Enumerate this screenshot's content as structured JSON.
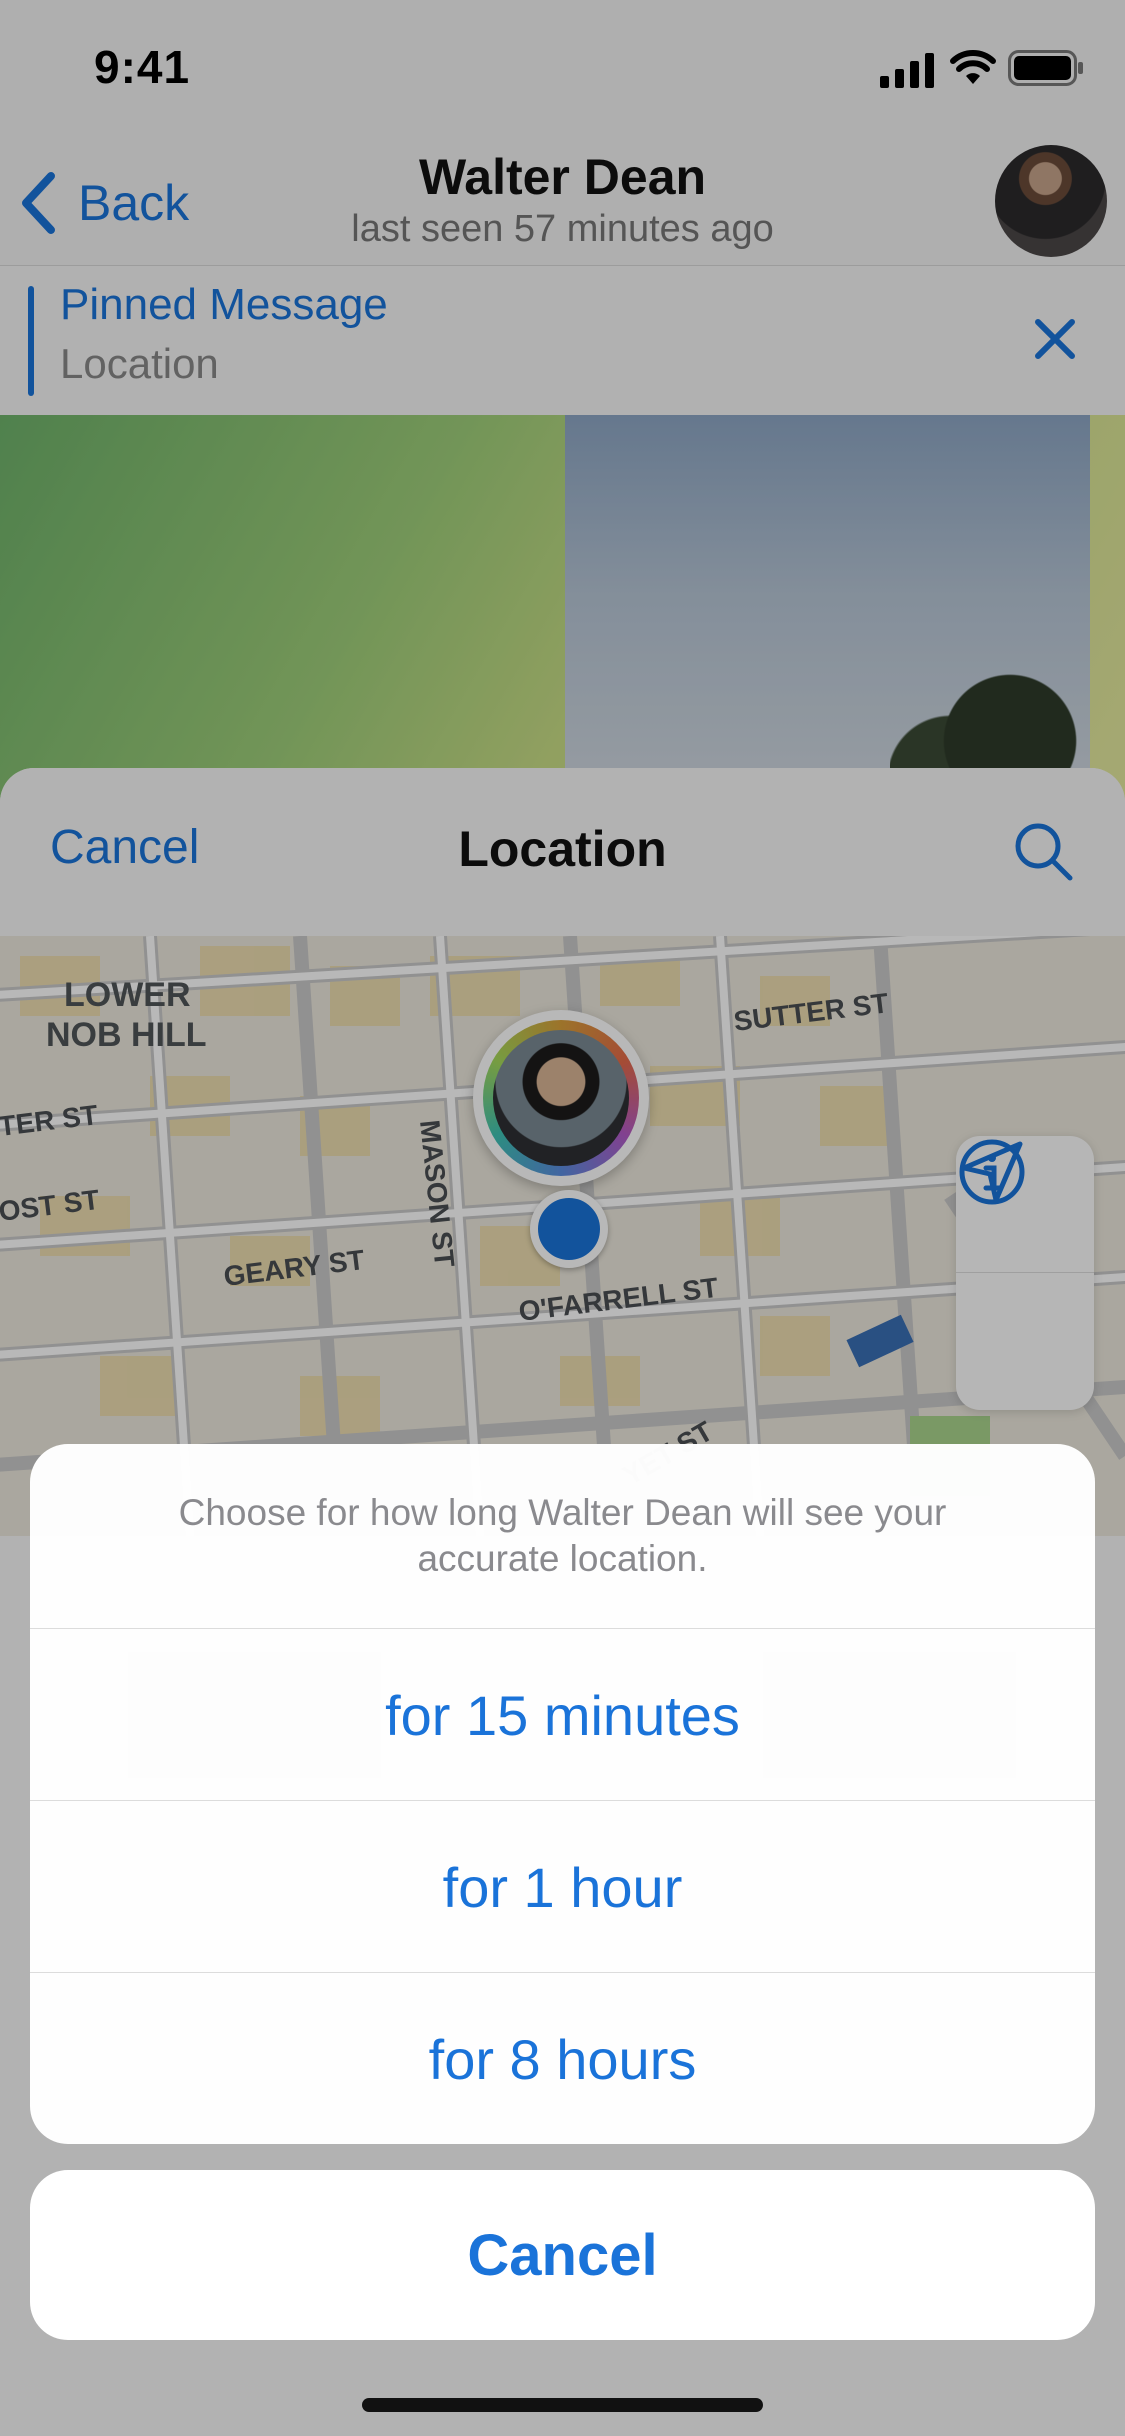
{
  "status_bar": {
    "time": "9:41"
  },
  "chat": {
    "back_label": "Back",
    "name": "Walter Dean",
    "status": "last seen 57 minutes ago"
  },
  "pinned": {
    "title": "Pinned Message",
    "subtitle": "Location"
  },
  "location_sheet": {
    "cancel_label": "Cancel",
    "title": "Location",
    "map_labels": {
      "district": [
        "LOWER",
        "NOB HILL"
      ],
      "streets": [
        "SUTTER ST",
        "MASON ST",
        "GEARY ST",
        "O'FARRELL ST",
        "TER ST",
        "OST ST",
        "YET ST",
        "ELLIS ST"
      ]
    }
  },
  "action_sheet": {
    "message": "Choose for how long Walter Dean will see your accurate location.",
    "options": [
      "for 15 minutes",
      "for 1 hour",
      "for 8 hours"
    ],
    "cancel_label": "Cancel"
  },
  "colors": {
    "accent": "#1a73d9",
    "secondary_text": "#8a8a8e"
  }
}
